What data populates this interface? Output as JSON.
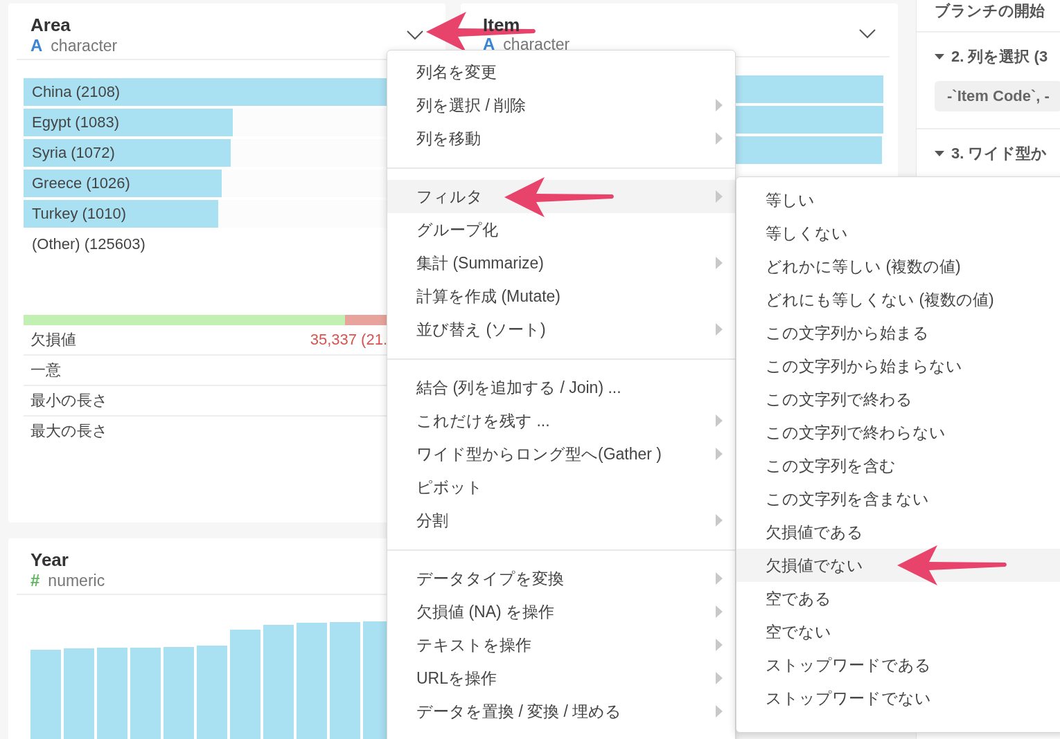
{
  "column_cards": [
    {
      "kind": "character",
      "title": "Area",
      "type_icon": "A",
      "type": "character",
      "top_values": [
        {
          "label": "China (2108)",
          "level": 1
        },
        {
          "label": "Egypt (1083)",
          "level": 0.514
        },
        {
          "label": "Syria (1072)",
          "level": 0.509
        },
        {
          "label": "Greece (1026)",
          "level": 0.487
        },
        {
          "label": "Turkey (1010)",
          "level": 0.479
        }
      ],
      "other": "(Other) (125603)",
      "missing_bar": {
        "level": 0.79
      },
      "stats": [
        {
          "label": "欠損値",
          "value": "35,337 (21."
        },
        {
          "label": "一意"
        },
        {
          "label": "最小の長さ"
        },
        {
          "label": "最大の長さ"
        }
      ]
    },
    {
      "kind": "character",
      "title": "Item",
      "type_icon": "A",
      "type": "character",
      "bars": [
        {
          "level": 1
        },
        {
          "level": 1
        },
        {
          "level": 0.996
        }
      ]
    },
    {
      "kind": "numeric",
      "title": "Year",
      "type_icon": "#",
      "type": "numeric"
    }
  ],
  "right_panel": {
    "branch_text": "ブランチの開始",
    "steps": [
      {
        "title": "2. 列を選択 (3",
        "expanded": true,
        "chip": "-`Item Code`, -"
      },
      {
        "title": "3. ワイド型か",
        "expanded": true
      }
    ]
  },
  "column_menu": {
    "sections": [
      {
        "items": [
          {
            "label": "列名を変更",
            "submenu": false,
            "selected": false
          },
          {
            "label": "列を選択 / 削除",
            "submenu": true,
            "selected": false
          },
          {
            "label": "列を移動",
            "submenu": true,
            "selected": false
          }
        ]
      },
      {
        "items": [
          {
            "label": "フィルタ",
            "submenu": true,
            "selected": true
          },
          {
            "label": "グループ化",
            "submenu": false,
            "selected": false
          },
          {
            "label": "集計 (Summarize)",
            "submenu": true,
            "selected": false
          },
          {
            "label": "計算を作成 (Mutate)",
            "submenu": false,
            "selected": false
          },
          {
            "label": "並び替え (ソート)",
            "submenu": true,
            "selected": false
          }
        ]
      },
      {
        "items": [
          {
            "label": "結合 (列を追加する / Join) ...",
            "submenu": false,
            "selected": false
          },
          {
            "label": "これだけを残す ...",
            "submenu": true,
            "selected": false
          },
          {
            "label": "ワイド型からロング型へ(Gather )",
            "submenu": true,
            "selected": false
          },
          {
            "label": "ピボット",
            "submenu": false,
            "selected": false
          },
          {
            "label": "分割",
            "submenu": true,
            "selected": false
          }
        ]
      },
      {
        "items": [
          {
            "label": "データタイプを変換",
            "submenu": true,
            "selected": false
          },
          {
            "label": "欠損値 (NA) を操作",
            "submenu": true,
            "selected": false
          },
          {
            "label": "テキストを操作",
            "submenu": true,
            "selected": false
          },
          {
            "label": "URLを操作",
            "submenu": true,
            "selected": false
          },
          {
            "label": "データを置換 / 変換 / 埋める",
            "submenu": true,
            "selected": false
          }
        ]
      }
    ]
  },
  "filter_submenu": {
    "items": [
      {
        "label": "等しい",
        "selected": false
      },
      {
        "label": "等しくない",
        "selected": false
      },
      {
        "label": "どれかに等しい (複数の値)",
        "selected": false
      },
      {
        "label": "どれにも等しくない (複数の値)",
        "selected": false
      },
      {
        "label": "この文字列から始まる",
        "selected": false
      },
      {
        "label": "この文字列から始まらない",
        "selected": false
      },
      {
        "label": "この文字列で終わる",
        "selected": false
      },
      {
        "label": "この文字列で終わらない",
        "selected": false
      },
      {
        "label": "この文字列を含む",
        "selected": false
      },
      {
        "label": "この文字列を含まない",
        "selected": false
      },
      {
        "label": "欠損値である",
        "selected": false
      },
      {
        "label": "欠損値でない",
        "selected": true
      },
      {
        "label": "空である",
        "selected": false
      },
      {
        "label": "空でない",
        "selected": false
      },
      {
        "label": "ストップワードである",
        "selected": false
      },
      {
        "label": "ストップワードでない",
        "selected": false
      }
    ]
  }
}
